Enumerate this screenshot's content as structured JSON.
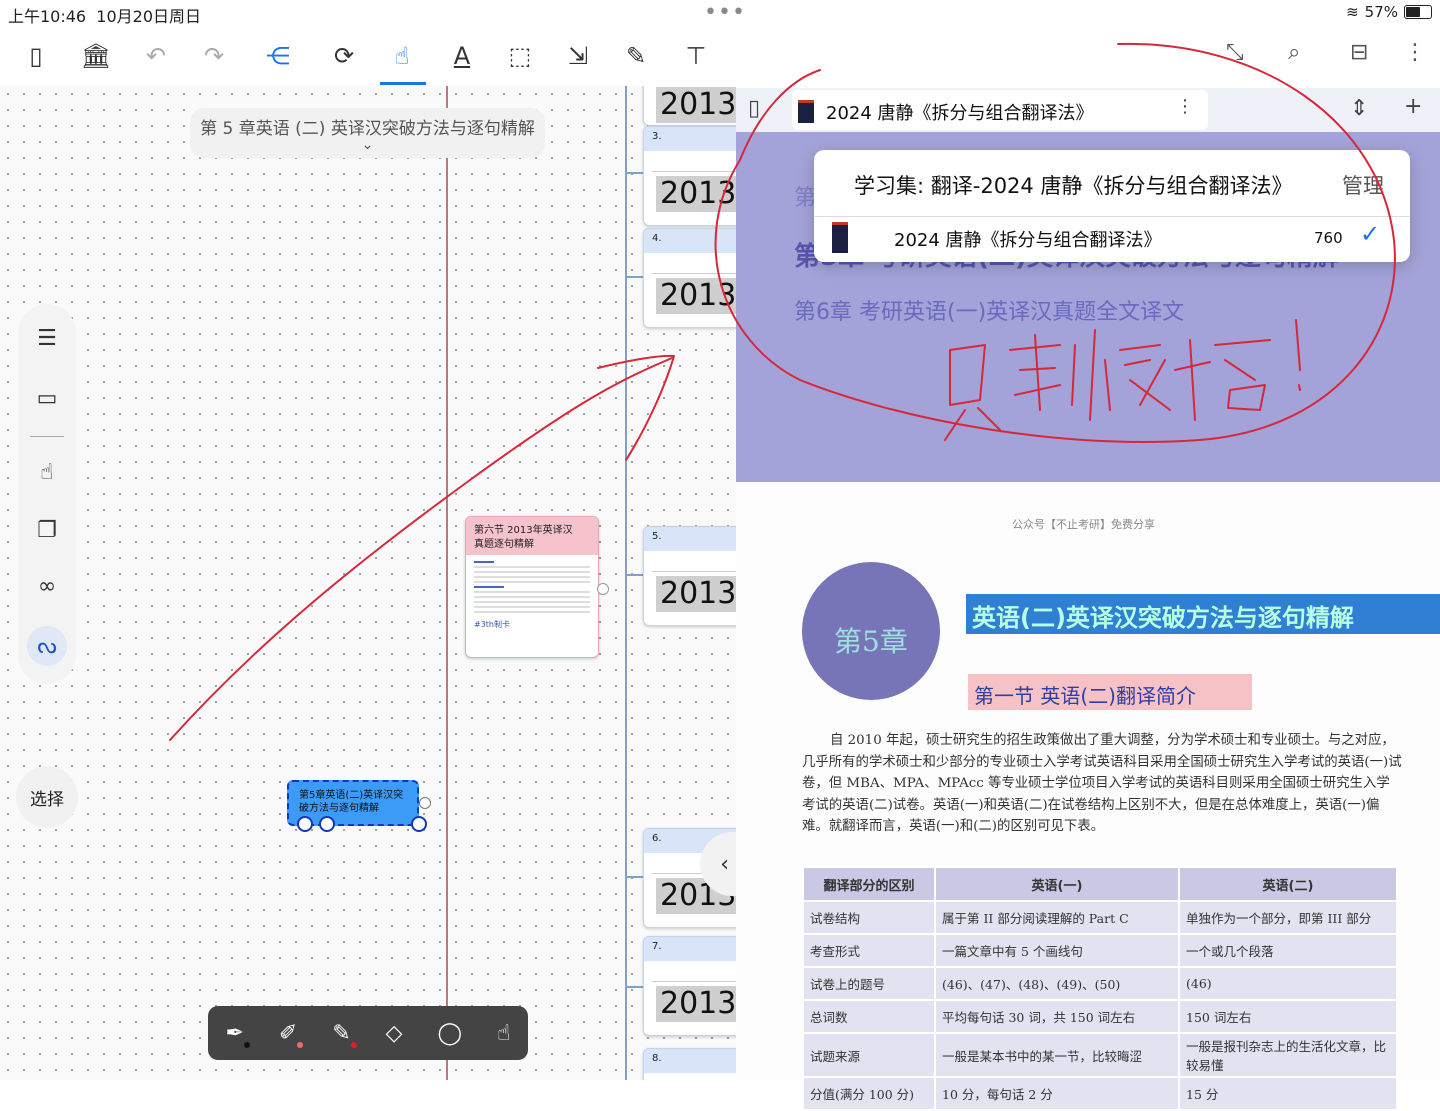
{
  "status_bar": {
    "time": "上午10:46",
    "date": "10月20日周日",
    "dots": "•••",
    "battery": "57%"
  },
  "toolbar": {
    "icons": [
      "sidebar-toggle-icon",
      "library-icon",
      "undo-icon",
      "redo-icon",
      "mindmap-icon",
      "sync-icon",
      "hand-pointer-icon",
      "text-icon",
      "frame-icon",
      "resize-icon",
      "pencil-icon",
      "textbox-icon",
      "image-icon"
    ],
    "active": "mindmap-icon"
  },
  "mindmap": {
    "title": "第 5 章英语 (二) 英译汉突破方法与逐句精解",
    "pink_node": {
      "title": "第六节  2013年英译汉真题逐句精解",
      "tag": "#3th制卡"
    },
    "blue_node": {
      "title": "第5章英语(二)英译汉突破方法与逐句精解"
    },
    "cards": [
      {
        "num": "3.",
        "big": "2013S"
      },
      {
        "num": "4.",
        "big": "2013S"
      },
      {
        "num": "5.",
        "big": "2013S"
      },
      {
        "num": "6.",
        "big": "2013S"
      },
      {
        "num": "7.",
        "big": "2013S"
      },
      {
        "num": "8.",
        "big": ""
      }
    ],
    "top_card_big": "2013S"
  },
  "side_panel": {
    "select_label": "选择"
  },
  "right_pane": {
    "tab_title": "2024 唐静《拆分与组合翻译法》",
    "popup": {
      "title": "学习集: 翻译-2024 唐静《拆分与组合翻译法》",
      "manage": "管理",
      "item": "2024 唐静《拆分与组合翻译法》",
      "count": "760"
    },
    "purple_page": {
      "line1": "第",
      "line2": "第5章  考研英语(二)英译汉突破方法与逐句精解",
      "line3": "第6章  考研英语(一)英译汉真题全文译文"
    },
    "page": {
      "credit": "公众号【不止考研】免费分享",
      "chapter": "第5章",
      "chapter_title": "英语(二)英译汉突破方法与逐句精解",
      "section": "第一节  英语(二)翻译简介",
      "paragraph": "自 2010 年起，硕士研究生的招生政策做出了重大调整，分为学术硕士和专业硕士。与之对应，几乎所有的学术硕士和少部分的专业硕士入学考试英语科目采用全国硕士研究生入学考试的英语(一)试卷，但 MBA、MPA、MPAcc 等专业硕士学位项目入学考试的英语科目则采用全国硕士研究生入学考试的英语(二)试卷。英语(一)和英语(二)在试卷结构上区别不大，但是在总体难度上，英语(一)偏难。就翻译而言，英语(一)和(二)的区别可见下表。",
      "table": {
        "headers": [
          "翻译部分的区别",
          "英语(一)",
          "英语(二)"
        ],
        "rows": [
          [
            "试卷结构",
            "属于第 II 部分阅读理解的 Part C",
            "单独作为一个部分，即第 III 部分"
          ],
          [
            "考查形式",
            "一篇文章中有 5 个画线句",
            "一个或几个段落"
          ],
          [
            "试卷上的题号",
            "(46)、(47)、(48)、(49)、(50)",
            "(46)"
          ],
          [
            "总词数",
            "平均每句话 30 词，共 150 词左右",
            "150 词左右"
          ],
          [
            "试题来源",
            "一般是某本书中的某一节，比较晦涩",
            "一般是报刊杂志上的生活化文章，比较易懂"
          ],
          [
            "分值(满分 100 分)",
            "10 分，每句话 2 分",
            "15 分"
          ]
        ]
      }
    }
  },
  "annotation": {
    "handwriting": "只剩1/2档!",
    "ink_color": "#d6283a"
  }
}
